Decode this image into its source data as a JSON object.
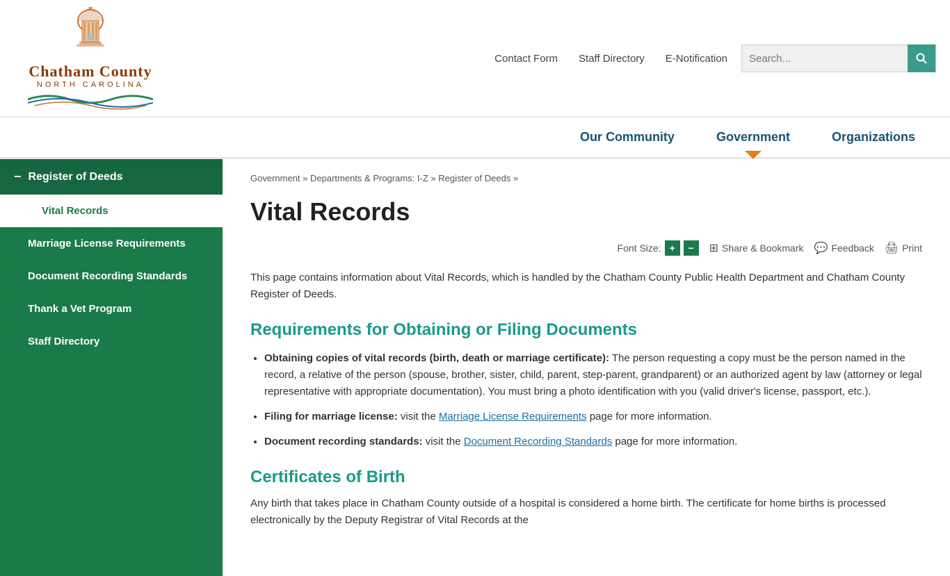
{
  "header": {
    "site_name": "Chatham County North Carolina",
    "nav_links": [
      {
        "label": "Contact Form",
        "id": "contact-form"
      },
      {
        "label": "Staff Directory",
        "id": "staff-directory-top"
      },
      {
        "label": "E-Notification",
        "id": "e-notification"
      }
    ],
    "search_placeholder": "Search..."
  },
  "main_nav": [
    {
      "label": "Our Community",
      "id": "our-community",
      "active": false
    },
    {
      "label": "Government",
      "id": "government",
      "active": true
    },
    {
      "label": "Organizations",
      "id": "organizations",
      "active": false
    }
  ],
  "sidebar": {
    "parent_label": "Register of Deeds",
    "items": [
      {
        "label": "Vital Records",
        "active": true,
        "indent": 1
      },
      {
        "label": "Marriage License Requirements",
        "active": false,
        "indent": 2
      },
      {
        "label": "Document Recording Standards",
        "active": false,
        "indent": 2
      },
      {
        "label": "Thank a Vet Program",
        "active": false,
        "indent": 2
      },
      {
        "label": "Staff Directory",
        "active": false,
        "indent": 2
      }
    ]
  },
  "breadcrumb": {
    "items": [
      {
        "label": "Government",
        "link": true
      },
      {
        "label": "Departments & Programs: I-Z",
        "link": true
      },
      {
        "label": "Register of Deeds",
        "link": true
      }
    ],
    "separator": "»"
  },
  "page": {
    "title": "Vital Records",
    "toolbar": {
      "font_size_label": "Font Size:",
      "increase_label": "+",
      "decrease_label": "−",
      "share_bookmark_label": "Share & Bookmark",
      "feedback_label": "Feedback",
      "print_label": "Print"
    },
    "intro": "This page contains information about Vital Records, which is handled by the Chatham County Public Health Department and Chatham County Register of Deeds.",
    "section1_heading": "Requirements for Obtaining or Filing Documents",
    "bullet1_bold": "Obtaining copies of vital records (birth, death or marriage certificate):",
    "bullet1_text": "  The person requesting a copy must be the person named in the record, a relative of the person (spouse, brother, sister, child, parent, step-parent, grandparent) or an authorized agent by law (attorney or legal representative with appropriate documentation). You must bring a photo identification with you (valid driver's license, passport, etc.).",
    "bullet2_bold": "Filing for marriage license:",
    "bullet2_text": " visit the ",
    "bullet2_link": "Marriage License Requirements",
    "bullet2_text2": " page for more information.",
    "bullet3_bold": "Document recording standards:",
    "bullet3_text": " visit the ",
    "bullet3_link": "Document Recording Standards",
    "bullet3_text2": " page for more information.",
    "section2_heading": "Certificates of Birth",
    "cert_text": "Any birth that takes place in Chatham County outside of a hospital is considered a home birth. The certificate for home births is processed electronically by the Deputy Registrar of Vital Records at the"
  }
}
